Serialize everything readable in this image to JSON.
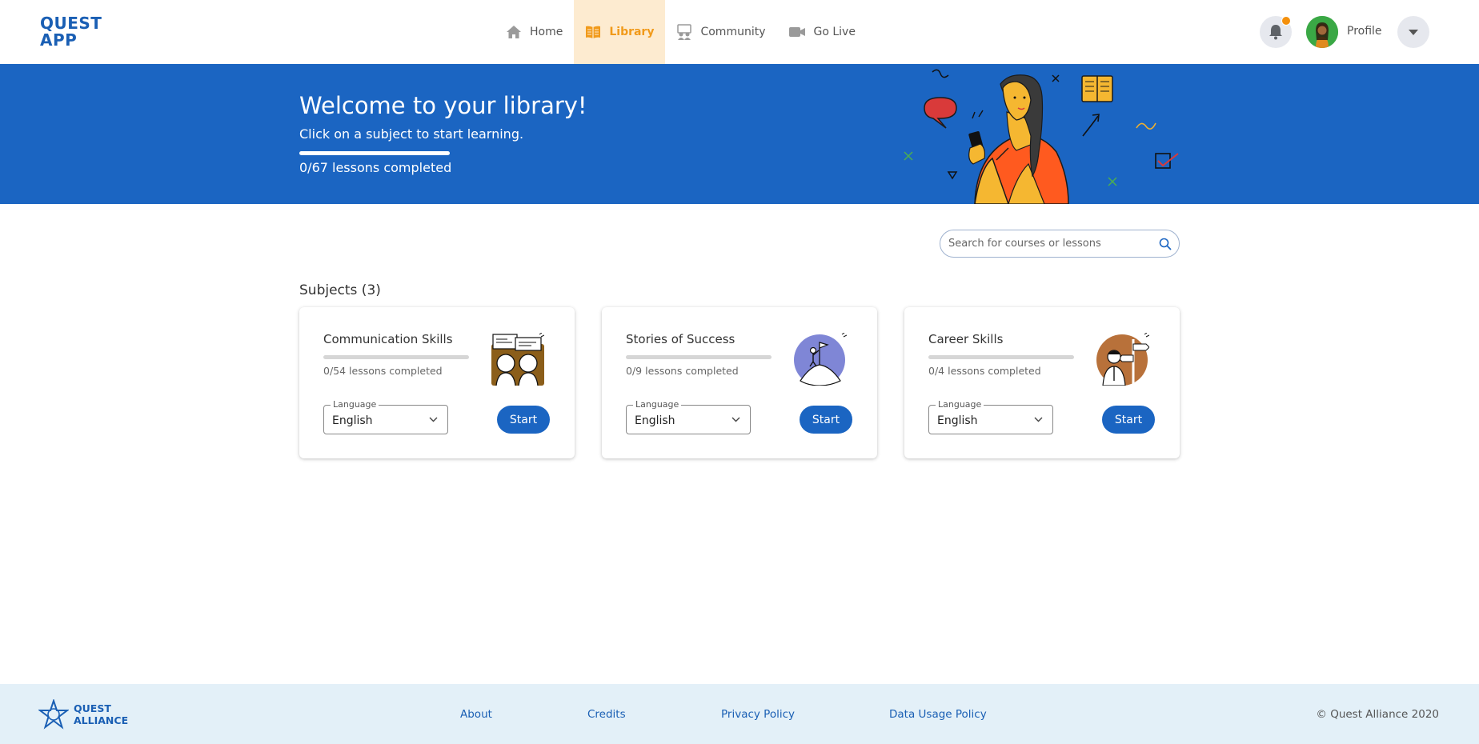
{
  "header": {
    "logo_line1": "QUEST",
    "logo_line2": "APP",
    "nav": [
      {
        "label": "Home",
        "icon": "home-icon",
        "active": false
      },
      {
        "label": "Library",
        "icon": "book-icon",
        "active": true
      },
      {
        "label": "Community",
        "icon": "community-icon",
        "active": false
      },
      {
        "label": "Go Live",
        "icon": "video-icon",
        "active": false
      }
    ],
    "profile_label": "Profile"
  },
  "banner": {
    "title": "Welcome to your library!",
    "subtitle": "Click on a subject to start learning.",
    "progress": "0/67 lessons completed",
    "progress_fraction": 0
  },
  "search": {
    "placeholder": "Search for courses or lessons"
  },
  "subjects": {
    "heading": "Subjects (3)",
    "cards": [
      {
        "title": "Communication Skills",
        "progress": "0/54 lessons completed",
        "language_label": "Language",
        "language": "English",
        "start": "Start"
      },
      {
        "title": "Stories of Success",
        "progress": "0/9 lessons completed",
        "language_label": "Language",
        "language": "English",
        "start": "Start"
      },
      {
        "title": "Career Skills",
        "progress": "0/4 lessons completed",
        "language_label": "Language",
        "language": "English",
        "start": "Start"
      }
    ]
  },
  "footer": {
    "logo_line1": "QUEST",
    "logo_line2": "ALLIANCE",
    "links": [
      "About",
      "Credits",
      "Privacy Policy",
      "Data Usage Policy"
    ],
    "copyright": "© Quest Alliance 2020"
  },
  "colors": {
    "brand_blue": "#1b65c2",
    "accent_orange": "#f19a1a",
    "footer_bg": "#e3f0f8"
  }
}
